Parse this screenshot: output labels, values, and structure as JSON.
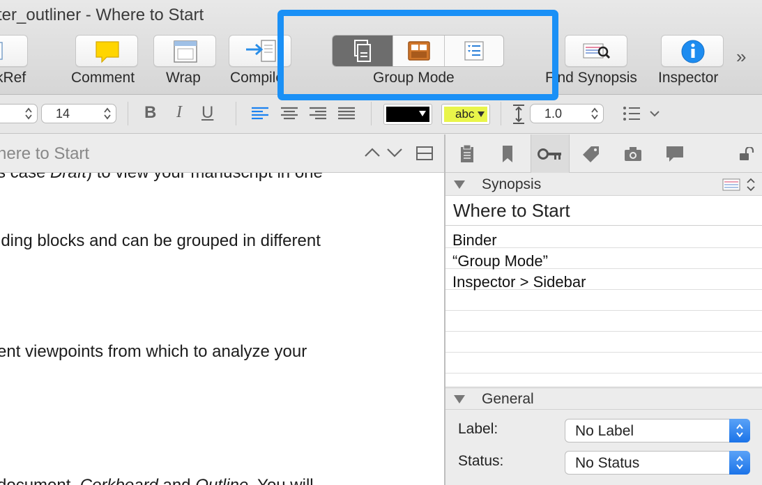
{
  "window": {
    "title": "ter_outliner - Where to Start"
  },
  "toolbar": {
    "buttons": [
      {
        "id": "quickref",
        "label": "kRef"
      },
      {
        "id": "comment",
        "label": "Comment"
      },
      {
        "id": "wrap",
        "label": "Wrap"
      },
      {
        "id": "compile",
        "label": "Compile"
      },
      {
        "id": "group_mode",
        "label": "Group Mode"
      },
      {
        "id": "find_synopsis",
        "label": "Find Synopsis"
      },
      {
        "id": "inspector",
        "label": "Inspector"
      }
    ],
    "overflow": "»",
    "highlight_color": "#1a90f6"
  },
  "format_bar": {
    "font_size": "14",
    "bold": "B",
    "italic": "I",
    "underline": "U",
    "text_color": "#000000",
    "highlight_color": "#e9f54a",
    "highlight_label": "abc",
    "line_spacing": "1.0"
  },
  "editor": {
    "header_title": "here to Start",
    "lines": [
      {
        "before": "s case ",
        "em": "Draft",
        "after": ") to view your manuscript in one"
      },
      {
        "text": "lding blocks and can be grouped in different"
      },
      {
        "text": "ent viewpoints from which to analyze your"
      },
      {
        "before": " document, ",
        "em": "Corkboard",
        "mid": " and ",
        "em2": "Outline",
        "after": ". You will"
      }
    ]
  },
  "inspector": {
    "synopsis_label": "Synopsis",
    "synopsis_title": "Where to Start",
    "synopsis_lines": [
      "Binder",
      "“Group Mode”",
      "Inspector > Sidebar"
    ],
    "general_label": "General",
    "fields": [
      {
        "label": "Label:",
        "value": "No Label"
      },
      {
        "label": "Status:",
        "value": "No Status"
      }
    ]
  }
}
